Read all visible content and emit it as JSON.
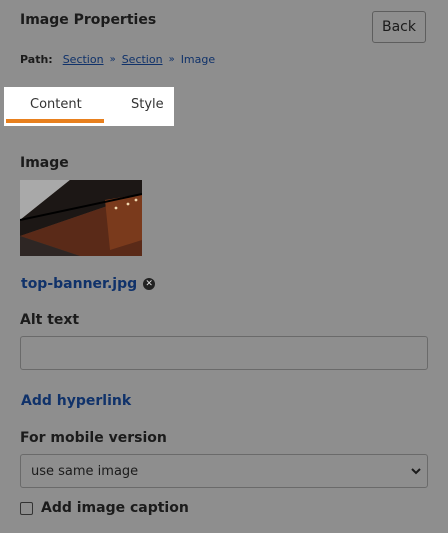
{
  "header": {
    "title": "Image Properties",
    "back_label": "Back"
  },
  "breadcrumb": {
    "label": "Path:",
    "items": [
      "Section",
      "Section"
    ],
    "current": "Image",
    "separator": "»"
  },
  "tabs": [
    {
      "label": "Content",
      "active": true
    },
    {
      "label": "Style",
      "active": false
    }
  ],
  "image_section": {
    "label": "Image",
    "filename": "top-banner.jpg",
    "remove_icon": "close-circle-icon"
  },
  "alt_text": {
    "label": "Alt text",
    "value": ""
  },
  "hyperlink": {
    "label": "Add hyperlink"
  },
  "mobile": {
    "label": "For mobile version",
    "selected": "use same image"
  },
  "caption": {
    "label": "Add image caption",
    "checked": false
  },
  "colors": {
    "accent": "#e8801e",
    "link": "#10326a",
    "overlay": "#8e8e8e"
  }
}
